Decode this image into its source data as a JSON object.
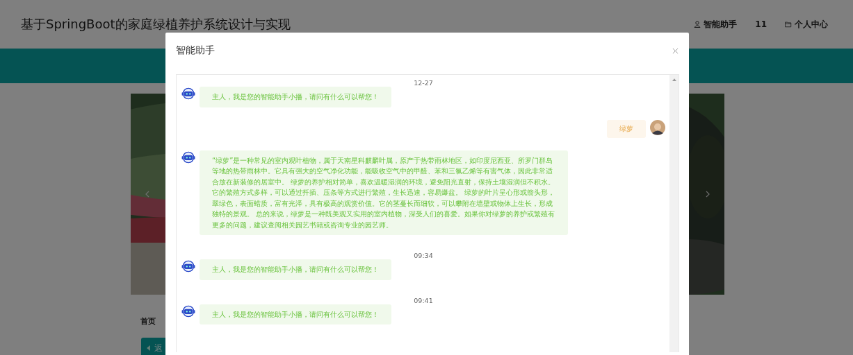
{
  "header": {
    "title": "基于SpringBoot的家庭绿植养护系统设计与实现",
    "links": [
      {
        "kind": "assistant",
        "label": "智能助手"
      },
      {
        "kind": "count",
        "label": "11"
      },
      {
        "kind": "profile",
        "label": "个人中心"
      }
    ]
  },
  "page": {
    "breadcrumb": "首页",
    "back_button": "返"
  },
  "dialog": {
    "title": "智能助手",
    "messages": [
      {
        "kind": "time",
        "text": "12-27"
      },
      {
        "kind": "bot",
        "text": "主人，我是您的智能助手小播，请问有什么可以帮您！"
      },
      {
        "kind": "user",
        "text": "绿萝"
      },
      {
        "kind": "bot",
        "text": "“绿萝”是一种常见的室内观叶植物，属于天南星科麒麟叶属，原产于热带雨林地区，如印度尼西亚、所罗门群岛等地的热带雨林中。它具有强大的空气净化功能，能吸收空气中的甲醛、苯和三氯乙烯等有害气体，因此非常适合放在新装修的居室中。 绿萝的养护相对简单，喜欢温暖湿润的环境，避免阳光直射，保持土壤湿润但不积水。它的繁殖方式多样，可以通过扦插、压条等方式进行繁殖，生长迅速，容易爆盆。 绿萝的叶片呈心形或箭头形，翠绿色，表面蜡质，富有光泽，具有极高的观赏价值。它的茎蔓长而细软，可以攀附在墙壁或物体上生长，形成独特的景观。 总的来说，绿萝是一种既美观又实用的室内植物，深受人们的喜爱。如果你对绿萝的养护或繁殖有更多的问题，建议查阅相关园艺书籍或咨询专业的园艺师。"
      },
      {
        "kind": "time",
        "text": "09:34"
      },
      {
        "kind": "bot",
        "text": "主人，我是您的智能助手小播，请问有什么可以帮您！"
      },
      {
        "kind": "time",
        "text": "09:41"
      },
      {
        "kind": "bot",
        "text": "主人，我是您的智能助手小播，请问有什么可以帮您！"
      }
    ]
  }
}
